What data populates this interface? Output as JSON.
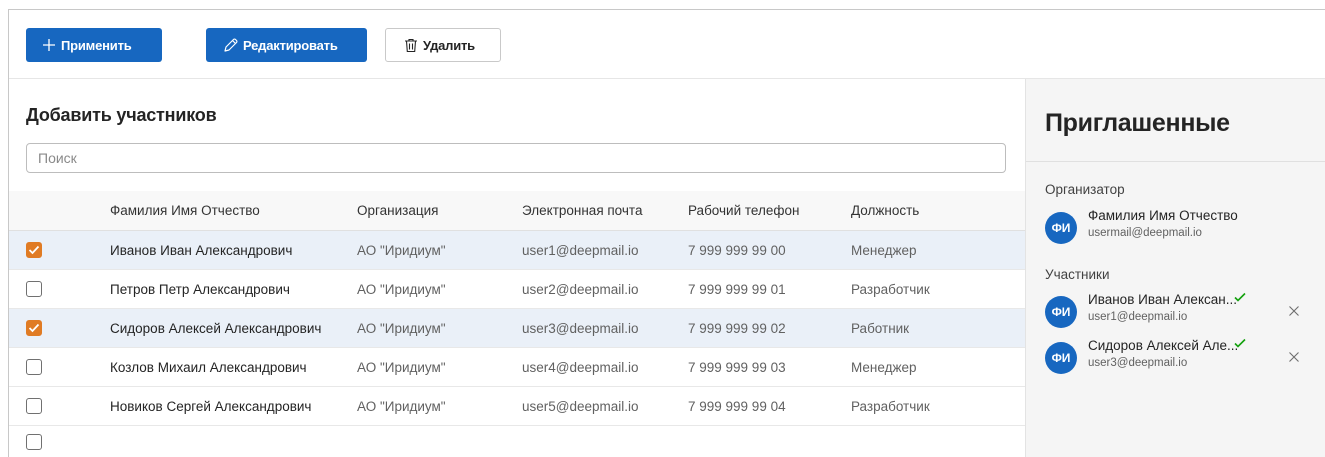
{
  "toolbar": {
    "apply_label": "Применить",
    "edit_label": "Редактировать",
    "delete_label": "Удалить"
  },
  "add_participants": {
    "title": "Добавить участников",
    "search_placeholder": "Поиск",
    "columns": {
      "name": "Фамилия Имя Отчество",
      "org": "Организация",
      "email": "Электронная почта",
      "phone": "Рабочий телефон",
      "position": "Должность"
    },
    "rows": [
      {
        "checked": true,
        "name": "Иванов Иван Александрович",
        "org": "АО \"Иридиум\"",
        "email": "user1@deepmail.io",
        "phone": "7 999 999 99 00",
        "position": "Менеджер"
      },
      {
        "checked": false,
        "name": "Петров Петр Александрович",
        "org": "АО \"Иридиум\"",
        "email": "user2@deepmail.io",
        "phone": "7 999 999 99 01",
        "position": "Разработчик"
      },
      {
        "checked": true,
        "name": "Сидоров Алексей Александрович",
        "org": "АО \"Иридиум\"",
        "email": "user3@deepmail.io",
        "phone": "7 999 999 99 02",
        "position": "Работник"
      },
      {
        "checked": false,
        "name": "Козлов Михаил Александрович",
        "org": "АО \"Иридиум\"",
        "email": "user4@deepmail.io",
        "phone": "7 999 999 99 03",
        "position": "Менеджер"
      },
      {
        "checked": false,
        "name": "Новиков Сергей Александрович",
        "org": "АО \"Иридиум\"",
        "email": "user5@deepmail.io",
        "phone": "7 999 999 99 04",
        "position": "Разработчик"
      }
    ]
  },
  "invited": {
    "title": "Приглашенные",
    "organizer_label": "Организатор",
    "organizer": {
      "initials": "ФИ",
      "name": "Фамилия Имя Отчество",
      "email": "usermail@deepmail.io"
    },
    "participants_label": "Участники",
    "participants": [
      {
        "initials": "ФИ",
        "name": "Иванов Иван Алексан...",
        "email": "user1@deepmail.io"
      },
      {
        "initials": "ФИ",
        "name": "Сидоров Алексей Але...",
        "email": "user3@deepmail.io"
      }
    ]
  },
  "colors": {
    "primary": "#1767c0",
    "checkbox_checked": "#e07b24",
    "selected_row": "#eaf0f8",
    "success_check": "#13a10e"
  },
  "icons": {
    "apply": "plus-icon",
    "edit": "pencil-icon",
    "delete": "trash-icon",
    "accepted": "checkmark-icon",
    "remove": "close-icon"
  }
}
